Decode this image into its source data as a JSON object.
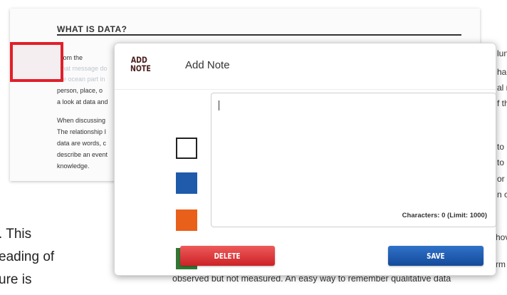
{
  "background_page": {
    "heading": "WHAT IS DATA?",
    "paragraph1": [
      "From the",
      "what message do",
      "are ocean part in",
      "person, place, o",
      "a look at data and"
    ],
    "paragraph2": [
      "When discussing",
      "The relationship I",
      "data are words, c",
      "describe an event",
      "knowledge."
    ],
    "right_fragments": [
      "lune",
      "hag",
      "al r",
      "f th",
      "to",
      "to",
      "or",
      "n c",
      "hov",
      "rm"
    ],
    "large_fragments": [
      ". This",
      "eading of",
      "ure is"
    ],
    "bottom_line": "observed but not measured. An easy way to remember qualitative data"
  },
  "dialog": {
    "logo_line1": "ADD",
    "logo_line2": "NOTE",
    "title": "Add Note",
    "note_text": "",
    "char_count": "Characters: 0 (Limit: 1000)",
    "colors": {
      "white": "#ffffff",
      "blue": "#1f5aab",
      "orange": "#e8601a",
      "green": "#347634"
    },
    "delete_label": "DELETE",
    "save_label": "SAVE"
  }
}
